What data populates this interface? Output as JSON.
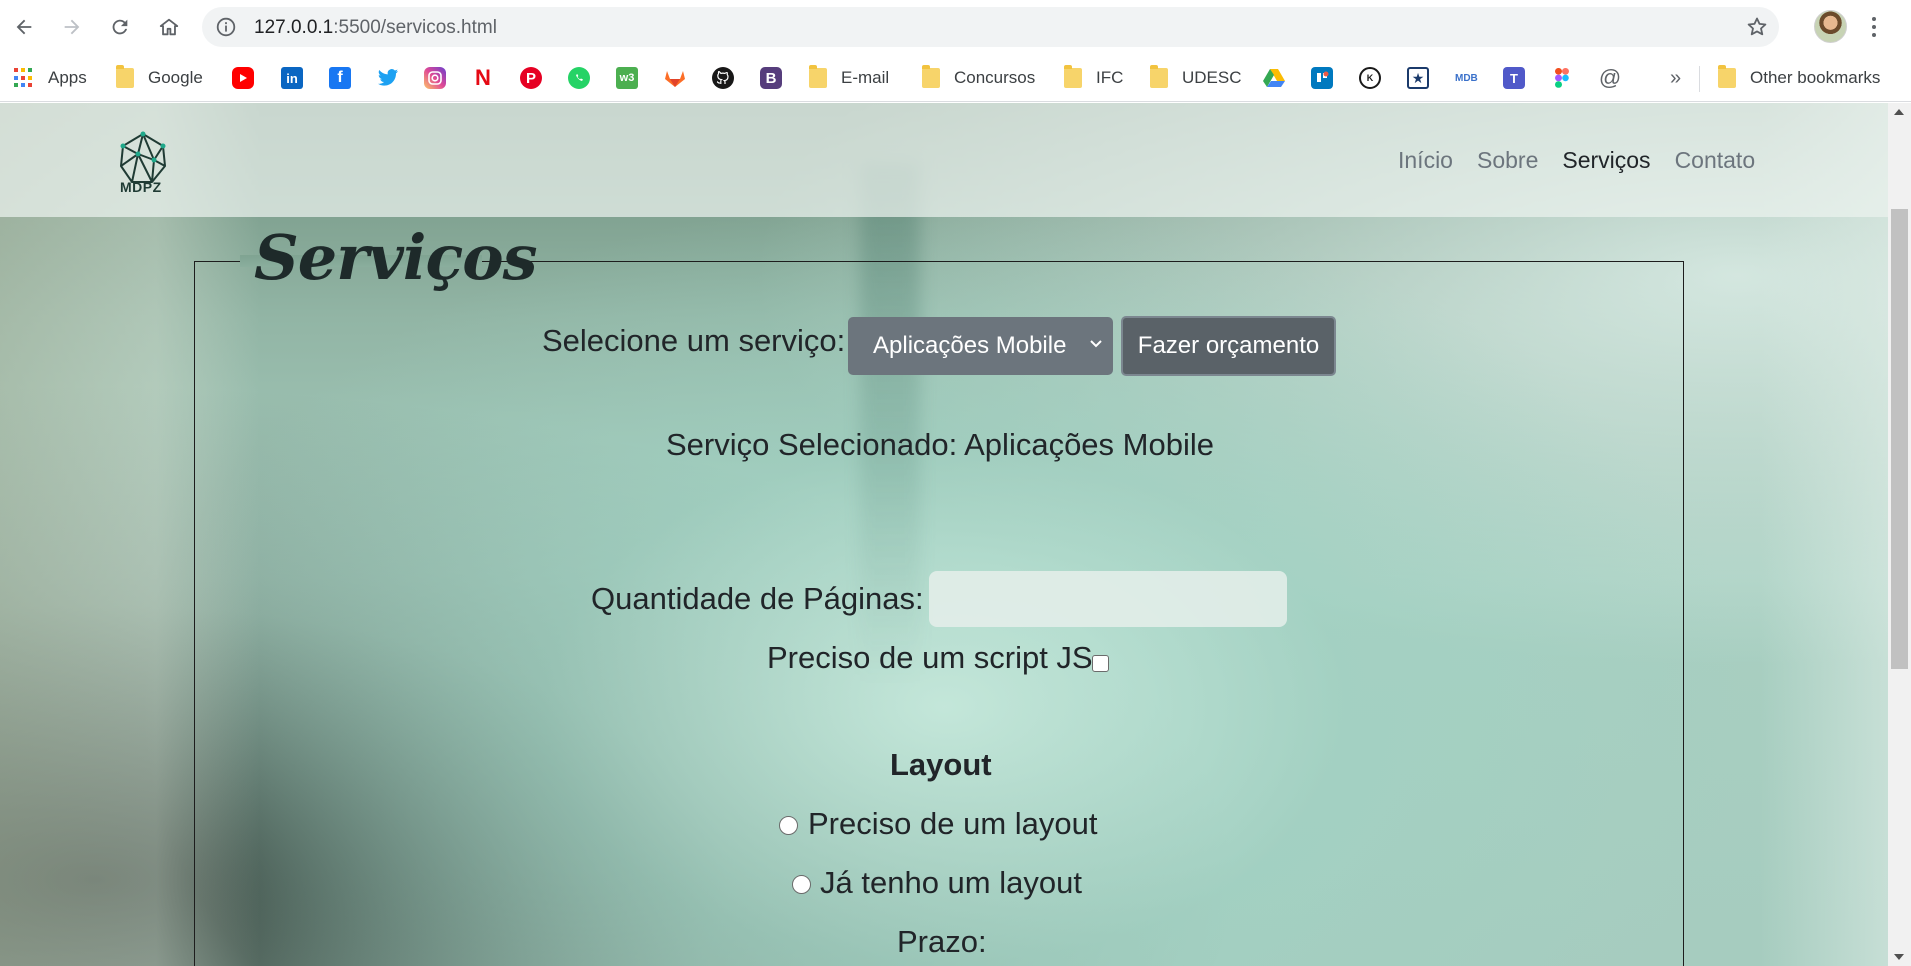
{
  "browser": {
    "url_host": "127.0.0.1",
    "url_rest": ":5500/servicos.html",
    "bookmarks": [
      {
        "label": "Apps",
        "type": "apps"
      },
      {
        "label": "Google",
        "type": "folder"
      },
      {
        "label": "E-mail",
        "type": "folder"
      },
      {
        "label": "Concursos",
        "type": "folder"
      },
      {
        "label": "IFC",
        "type": "folder"
      },
      {
        "label": "UDESC",
        "type": "folder"
      },
      {
        "label": "Other bookmarks",
        "type": "folder"
      }
    ],
    "overflow_label": "»",
    "icon_labels": {
      "mdb": "MDB"
    }
  },
  "navbar": {
    "logo_text": "MDPZ",
    "links": [
      "Início",
      "Sobre",
      "Serviços",
      "Contato"
    ],
    "active": "Serviços"
  },
  "page": {
    "legend": "Serviços",
    "select_label": "Selecione um serviço:",
    "select_value": "Aplicações Mobile",
    "budget_button": "Fazer orçamento",
    "selected_text": "Serviço Selecionado: Aplicações Mobile",
    "pages_label": "Quantidade de Páginas:",
    "pages_value": "",
    "script_label": "Preciso de um script JS",
    "layout_heading": "Layout",
    "layout_option_need": "Preciso de um layout",
    "layout_option_have": "Já tenho um layout",
    "deadline_label": "Prazo:"
  },
  "colors": {
    "select_bg": "#6c757d",
    "button_bg": "#5a6268",
    "nav_active": "#212529",
    "nav_inactive": "#6c757d"
  }
}
